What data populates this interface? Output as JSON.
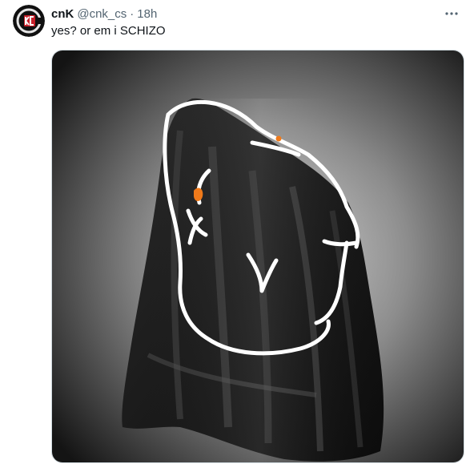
{
  "tweet": {
    "author": {
      "display_name": "cnK",
      "handle": "@cnk_cs",
      "avatar_icon": "cnk-logo-icon"
    },
    "separator": "·",
    "time": "18h",
    "more_icon": "more-horizontal-icon",
    "text": "yes? or em i SCHIZO",
    "media": {
      "description_icon": "fabric-drape-doodle-image"
    }
  },
  "colors": {
    "text_primary": "#0f1419",
    "text_secondary": "#536471",
    "border": "#cfd9de",
    "accent_orange": "#f07a1a"
  }
}
